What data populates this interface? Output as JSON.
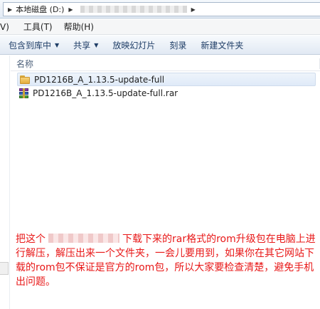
{
  "address": {
    "drive_label": "本地磁盘 (D:)"
  },
  "menubar": {
    "items": [
      "V)",
      "工具(T)",
      "帮助(H)"
    ]
  },
  "commandbar": {
    "items": [
      {
        "label": "包含到库中",
        "has_dropdown": true
      },
      {
        "label": "共享",
        "has_dropdown": true
      },
      {
        "label": "放映幻灯片",
        "has_dropdown": false
      },
      {
        "label": "刻录",
        "has_dropdown": false
      },
      {
        "label": "新建文件夹",
        "has_dropdown": false
      }
    ]
  },
  "filelist": {
    "column_header": "名称",
    "files": [
      {
        "name": "PD1216B_A_1.13.5-update-full",
        "icon": "folder-icon",
        "selected": true
      },
      {
        "name": "PD1216B_A_1.13.5-update-full.rar",
        "icon": "rar-archive-icon",
        "selected": false
      }
    ]
  },
  "annotation": {
    "part1": "把这个",
    "part2": "下载下来的rar格式的rom升级包在电脑上进行解压，解压出来一个文件夹，一会儿要用到，如果你在其它网站下载的rom包不保证是官方的rom包，所以大家要检查清楚，避免手机出问题。",
    "color": "#e81818"
  }
}
